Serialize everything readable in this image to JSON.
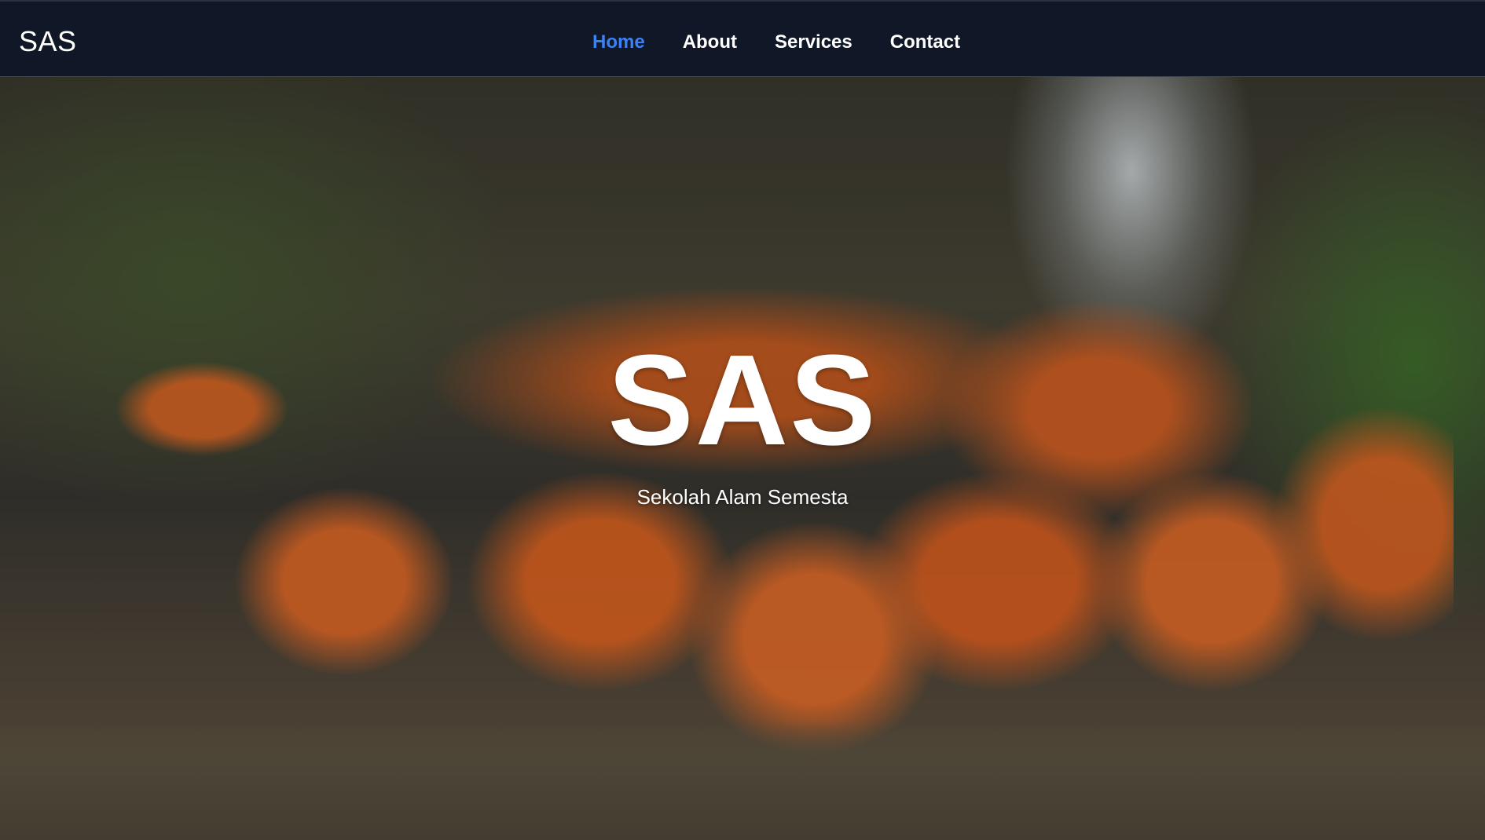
{
  "navbar": {
    "brand": "SAS",
    "links": [
      {
        "label": "Home",
        "active": true
      },
      {
        "label": "About",
        "active": false
      },
      {
        "label": "Services",
        "active": false
      },
      {
        "label": "Contact",
        "active": false
      }
    ]
  },
  "hero": {
    "title": "SAS",
    "subtitle": "Sekolah Alam Semesta"
  },
  "colors": {
    "navbar_bg": "#101727",
    "active_link": "#3b82f6",
    "text": "#ffffff"
  }
}
